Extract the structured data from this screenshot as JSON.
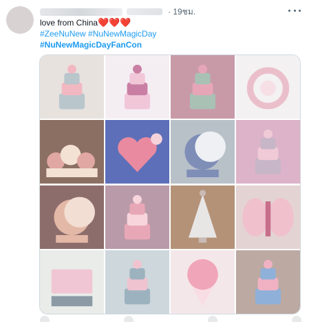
{
  "tweet": {
    "time": "· 19ชม.",
    "line1": "love from China",
    "hearts": "❤️❤️❤️",
    "line2": "#ZeeNuNew #NuNewMagicDay",
    "line3": "#NuNewMagicDayFanCon"
  },
  "images": [
    {
      "bg": "#e8e2de",
      "main": "#b9c6cc",
      "accent": "#f2b8c2",
      "shape": "cake"
    },
    {
      "bg": "#f4eef3",
      "main": "#f1c7d8",
      "accent": "#c97fa3",
      "shape": "cake"
    },
    {
      "bg": "#c89aa8",
      "main": "#a8c1b4",
      "accent": "#e7a6b8",
      "shape": "cake"
    },
    {
      "bg": "#f3f1f2",
      "main": "#eabfcb",
      "accent": "#f7dfe6",
      "shape": "ring"
    },
    {
      "bg": "#8b6f63",
      "main": "#e1a7a2",
      "accent": "#f3e1d3",
      "shape": "flowers"
    },
    {
      "bg": "#5d6fb8",
      "main": "#e98aa0",
      "accent": "#f6d3da",
      "shape": "heart"
    },
    {
      "bg": "#b8c0c8",
      "main": "#7f8eb7",
      "accent": "#eef0f4",
      "shape": "moon"
    },
    {
      "bg": "#dcb3c8",
      "main": "#c7b6c8",
      "accent": "#f0cad6",
      "shape": "cake"
    },
    {
      "bg": "#8d6d6b",
      "main": "#e3b8a6",
      "accent": "#f2ded3",
      "shape": "moon"
    },
    {
      "bg": "#b99aa8",
      "main": "#e8a7b7",
      "accent": "#f8d5dd",
      "shape": "cake"
    },
    {
      "bg": "#b49278",
      "main": "#e8e6e5",
      "accent": "#c9bbb6",
      "shape": "tree"
    },
    {
      "bg": "#e4d3d3",
      "main": "#f0c0cc",
      "accent": "#c76e8b",
      "shape": "wings"
    },
    {
      "bg": "#e9ece9",
      "main": "#f1c6d4",
      "accent": "#8b9aa5",
      "shape": "box"
    },
    {
      "bg": "#cdd7dc",
      "main": "#9db2bf",
      "accent": "#efc3cf",
      "shape": "cake"
    },
    {
      "bg": "#f4e7ea",
      "main": "#f1a5b8",
      "accent": "#f8dde4",
      "shape": "bouquet"
    },
    {
      "bg": "#bba9a2",
      "main": "#8fb0d8",
      "accent": "#f0b2c2",
      "shape": "cake"
    }
  ]
}
